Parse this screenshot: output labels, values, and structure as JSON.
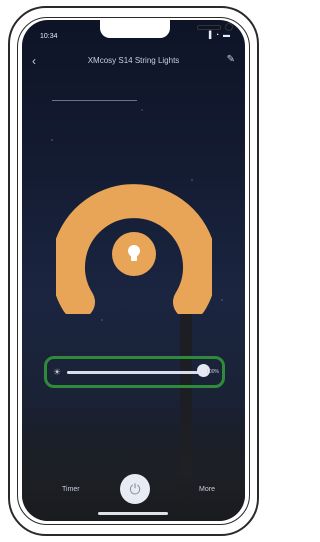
{
  "status": {
    "time": "10:34",
    "icons": "▌◔ ▬"
  },
  "header": {
    "title": "XMcosy S14 String Lights",
    "back_icon": "chevron-left-icon",
    "edit_icon": "pencil-icon"
  },
  "dial": {
    "ring_color": "#E8A558",
    "bulb_icon": "lightbulb-icon"
  },
  "brightness": {
    "level_percent": 100,
    "label": "100%",
    "icon": "sun-icon"
  },
  "footer": {
    "timer_label": "Timer",
    "more_label": "More",
    "power_icon": "power-icon"
  },
  "colors": {
    "accent": "#E8A558",
    "highlight": "#2E8B3A"
  }
}
